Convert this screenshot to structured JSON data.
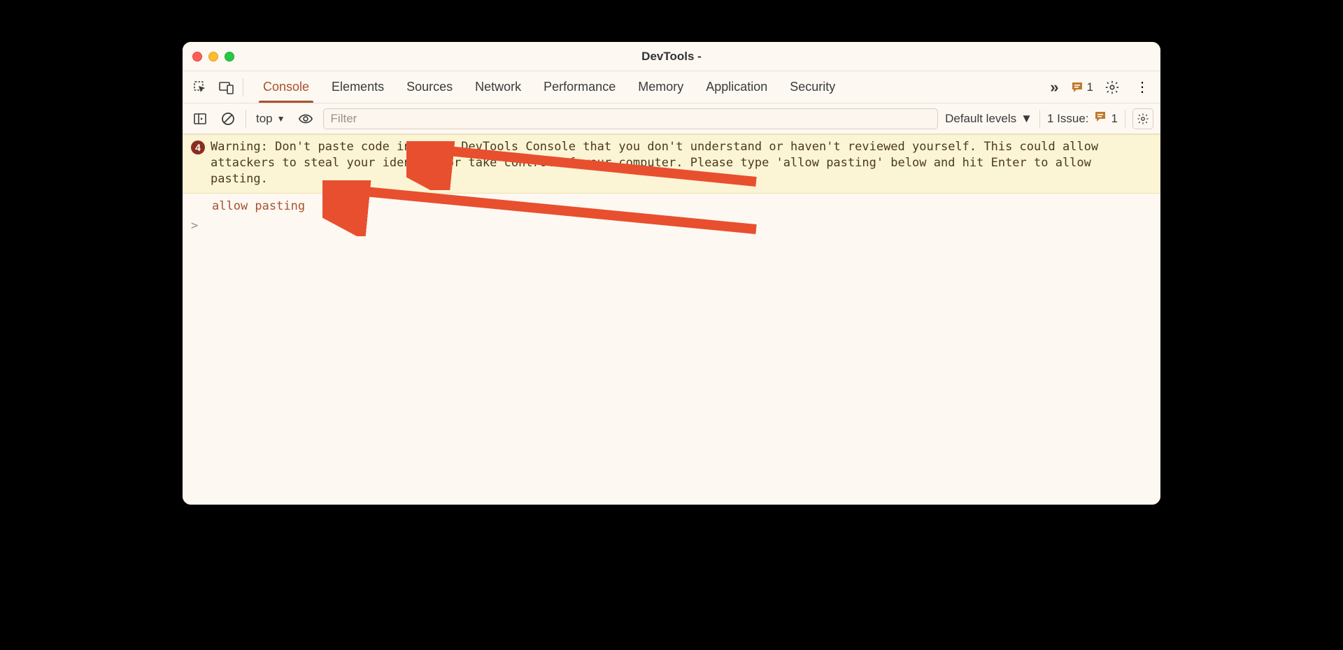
{
  "window": {
    "title": "DevTools -"
  },
  "tabs": {
    "items": [
      {
        "label": "Console",
        "active": true
      },
      {
        "label": "Elements",
        "active": false
      },
      {
        "label": "Sources",
        "active": false
      },
      {
        "label": "Network",
        "active": false
      },
      {
        "label": "Performance",
        "active": false
      },
      {
        "label": "Memory",
        "active": false
      },
      {
        "label": "Application",
        "active": false
      },
      {
        "label": "Security",
        "active": false
      }
    ],
    "overflow_badge_count": "1"
  },
  "toolbar": {
    "context": "top",
    "filter_placeholder": "Filter",
    "levels_label": "Default levels",
    "issues_label": "1 Issue:",
    "issues_count": "1"
  },
  "console": {
    "warning_count": "4",
    "warning_text": "Warning: Don't paste code into the DevTools Console that you don't understand or haven't reviewed yourself. This could allow attackers to steal your identity or take control of your computer. Please type 'allow pasting' below and hit Enter to allow pasting.",
    "typed_line": "allow pasting",
    "prompt_symbol": ">"
  },
  "annotation": {
    "arrow_color": "#e84f2e"
  }
}
